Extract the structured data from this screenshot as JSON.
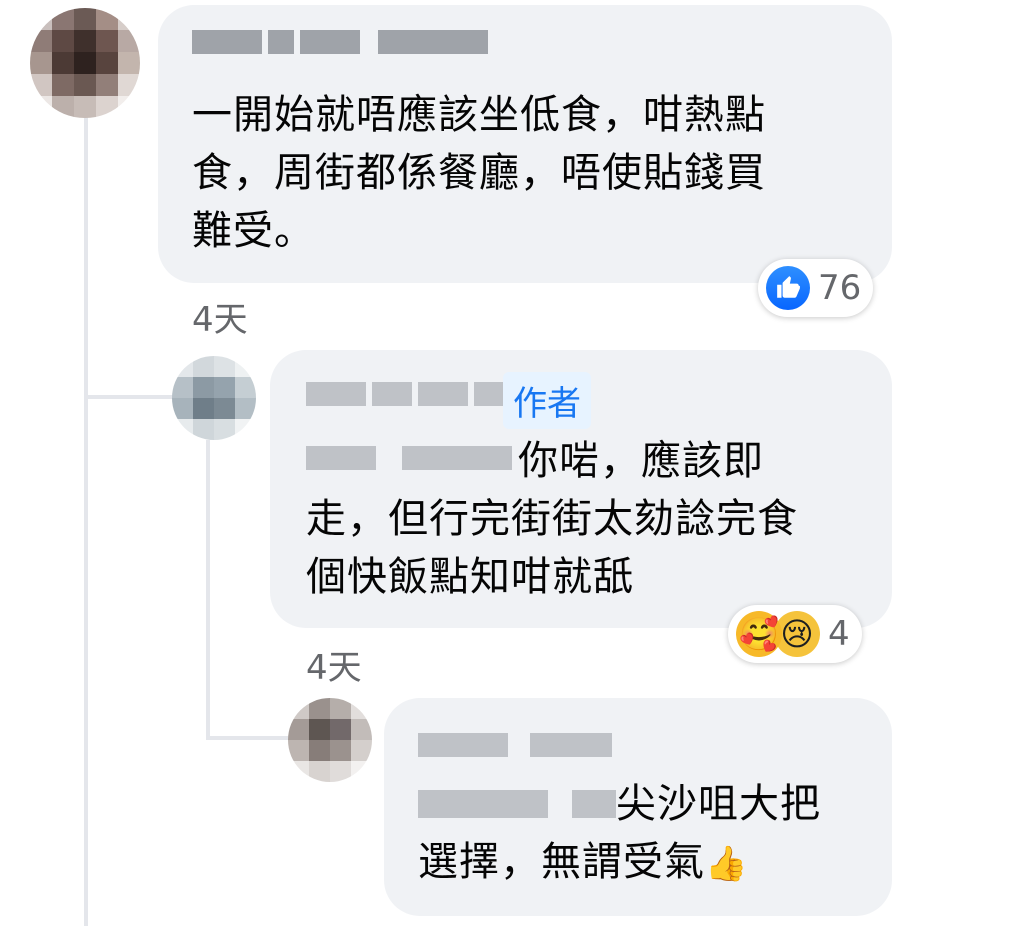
{
  "comments": [
    {
      "author_hidden": true,
      "text_lines": [
        "一開始就唔應該坐低食，咁熱點",
        "食，周街都係餐廳，唔使貼錢買",
        "難受。"
      ],
      "time": "4天",
      "reaction": {
        "type": "like-icon",
        "count": "76"
      }
    },
    {
      "author_hidden": true,
      "badge": "作者",
      "mention_hidden": true,
      "text_lines": [
        "你啱，應該即",
        "走，但行完街街太劾諗完食",
        "個快飯點知咁就舐"
      ],
      "time": "4天",
      "reaction": {
        "types": [
          "care-icon",
          "sad-icon"
        ],
        "count": "4"
      }
    },
    {
      "author_hidden": true,
      "mention_hidden": true,
      "text_lines": [
        "尖沙咀大把",
        "選擇，無謂受氣"
      ],
      "emoji": "👍"
    }
  ],
  "colors": {
    "bubble": "#f0f2f5",
    "accent": "#1877f2",
    "meta": "#65676b"
  }
}
